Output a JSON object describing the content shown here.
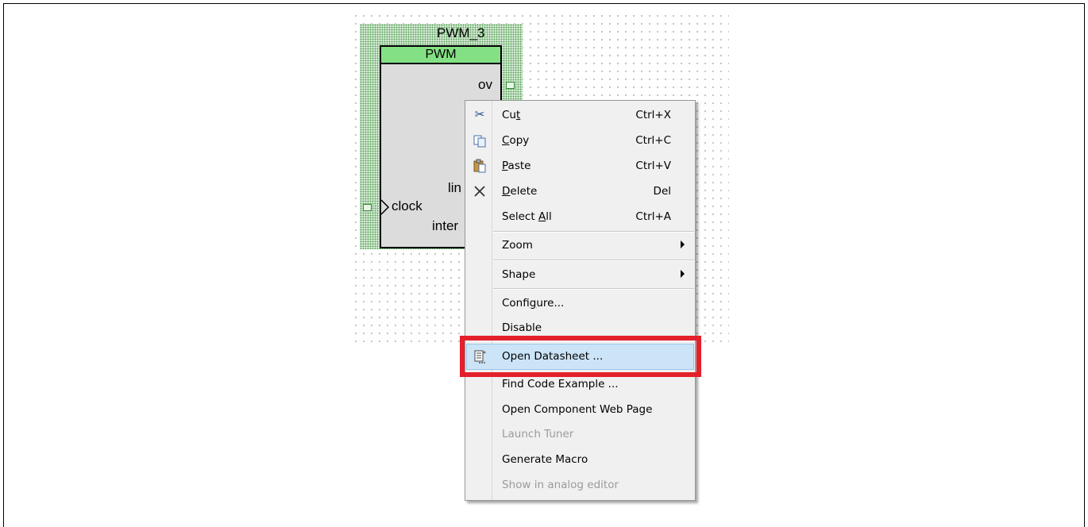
{
  "component": {
    "instance_name": "PWM_3",
    "type_label": "PWM",
    "pins": {
      "ov": "ov",
      "lin": "lin",
      "clock": "clock",
      "inter": "inter"
    }
  },
  "context_menu": {
    "items": [
      {
        "label": "Cut",
        "mnemonic_index": 2,
        "shortcut": "Ctrl+X",
        "icon": "scissors-icon",
        "enabled": true
      },
      {
        "label": "Copy",
        "mnemonic_index": 0,
        "shortcut": "Ctrl+C",
        "icon": "copy-icon",
        "enabled": true
      },
      {
        "label": "Paste",
        "mnemonic_index": 0,
        "shortcut": "Ctrl+V",
        "icon": "paste-icon",
        "enabled": true
      },
      {
        "label": "Delete",
        "mnemonic_index": 0,
        "shortcut": "Del",
        "icon": "delete-x-icon",
        "enabled": true
      },
      {
        "label": "Select All",
        "mnemonic_index": 7,
        "shortcut": "Ctrl+A",
        "icon": "",
        "enabled": true
      },
      {
        "label": "Zoom",
        "submenu": true,
        "enabled": true
      },
      {
        "label": "Shape",
        "submenu": true,
        "enabled": true
      },
      {
        "label": "Configure...",
        "mnemonic_index": 6,
        "enabled": true
      },
      {
        "label": "Disable",
        "enabled": true
      },
      {
        "label": "Open Datasheet ...",
        "icon": "datasheet-icon",
        "enabled": true,
        "highlighted": true
      },
      {
        "label": "Find Code Example ...",
        "enabled": true
      },
      {
        "label": "Open Component Web Page",
        "enabled": true
      },
      {
        "label": "Launch Tuner",
        "enabled": false
      },
      {
        "label": "Generate Macro",
        "enabled": true
      },
      {
        "label": "Show in analog editor",
        "enabled": false
      }
    ]
  },
  "colors": {
    "highlight": "#cce4f7",
    "annotation_red": "#e3202c",
    "component_header": "#84e084"
  }
}
